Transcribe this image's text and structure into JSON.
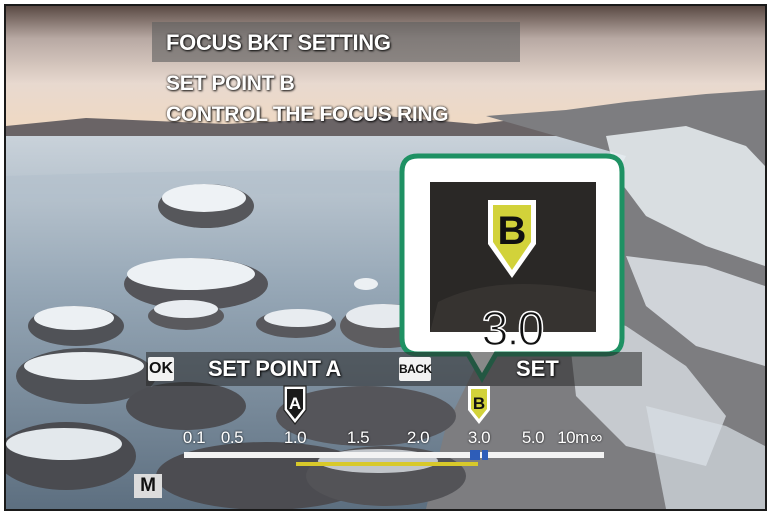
{
  "screen": {
    "title": "FOCUS BKT SETTING",
    "instruction_line1": "SET POINT B",
    "instruction_line2": "CONTROL THE FOCUS RING"
  },
  "actions": {
    "ok_key": "OK",
    "ok_action": "SET POINT A",
    "back_key": "BACK",
    "back_action": "SET"
  },
  "focus_scale": {
    "labels": [
      "0.1",
      "0.5",
      "1.0",
      "1.5",
      "2.0",
      "3.0",
      "5.0",
      "10m",
      "∞"
    ],
    "unit": "m",
    "point_a": {
      "marker": "A",
      "distance": "1.0"
    },
    "point_b": {
      "marker": "B",
      "distance": "3.0"
    }
  },
  "zoom_preview": {
    "marker": "B",
    "value": "3.0"
  },
  "mode_badge": "M",
  "colors": {
    "callout_border": "#1e9163",
    "marker_b": "#d2d23a",
    "marker_a": "#ffffff",
    "range_bar": "#d8c92a",
    "cursor": "#2e5db8"
  }
}
